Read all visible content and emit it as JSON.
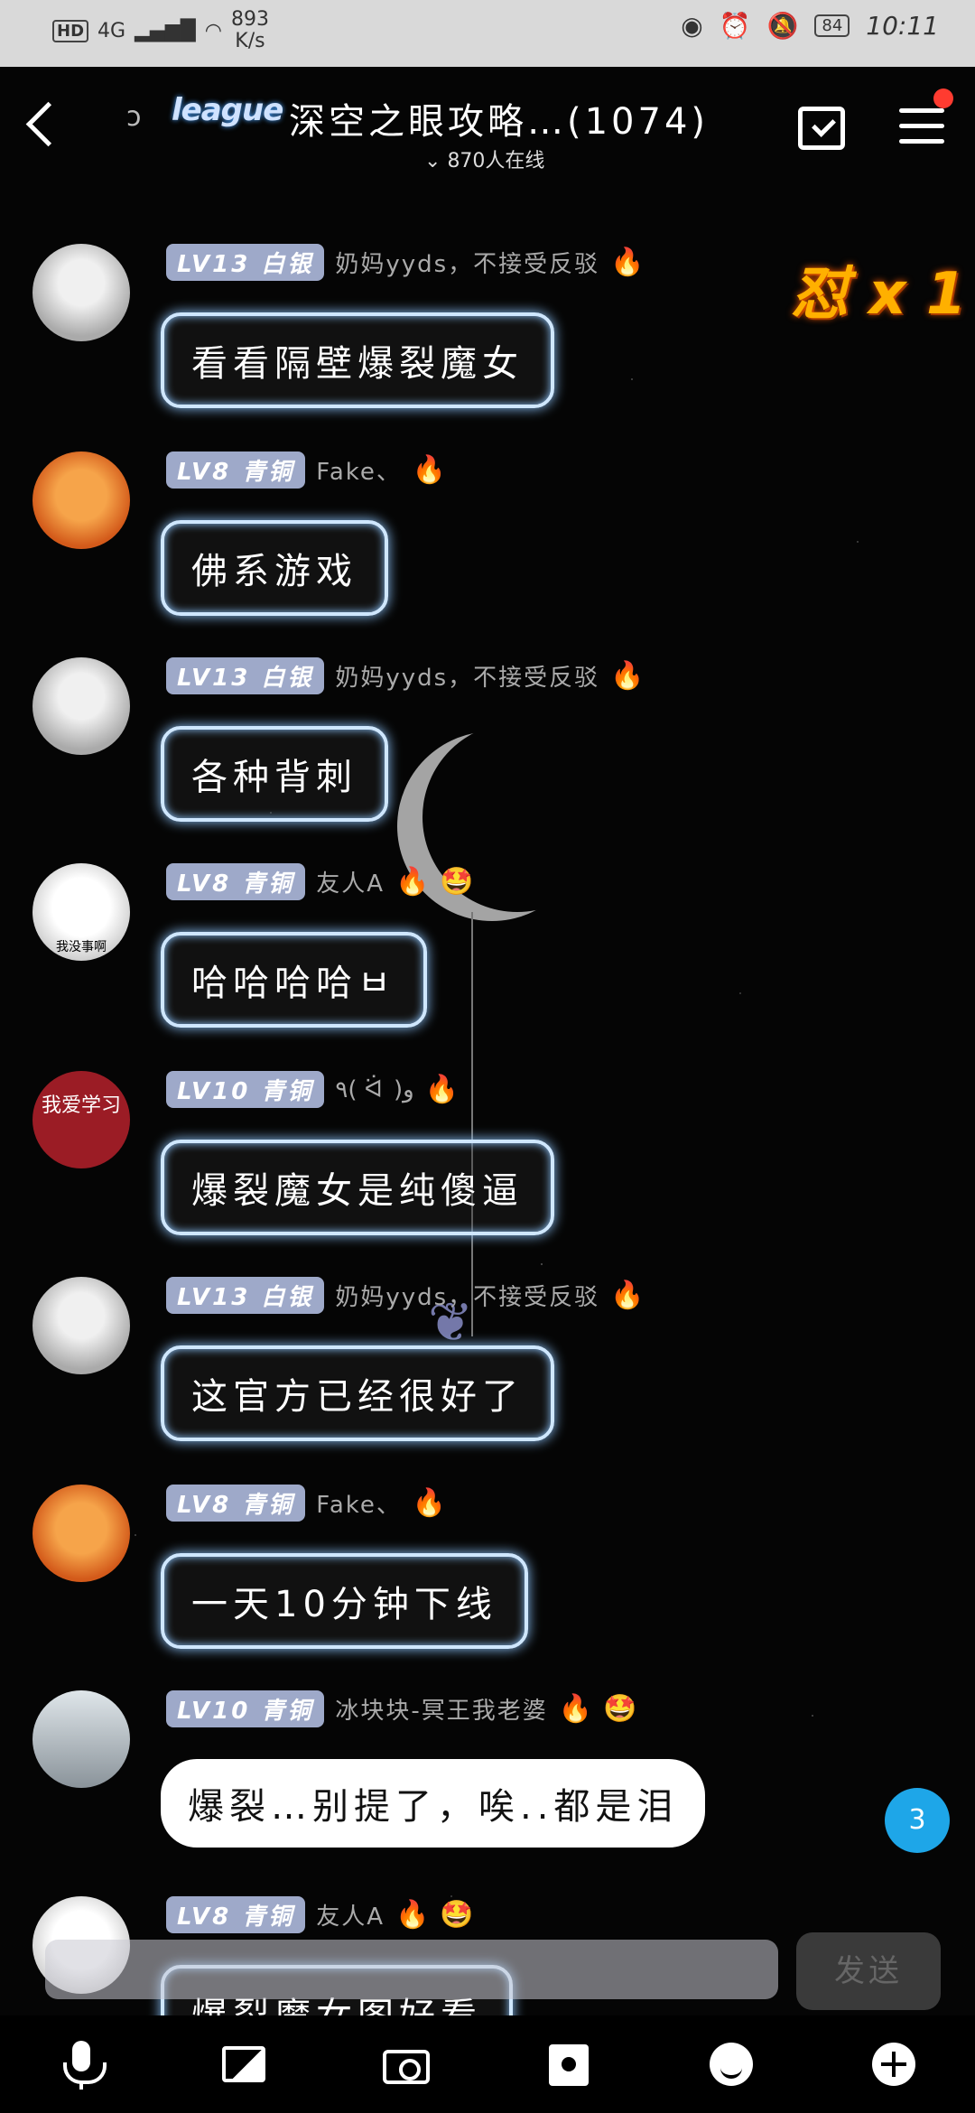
{
  "status_bar": {
    "network": "4G",
    "hd": "HD",
    "speed": "893\nK/s",
    "battery": "84",
    "time": "10:11"
  },
  "header": {
    "logo_text": "league",
    "title": "深空之眼攻略…(1074)",
    "online": "870人在线"
  },
  "combo": "怼 x 1",
  "messages": [
    {
      "level": "LV13 白银",
      "nick": "奶妈yyds，不接受反驳",
      "badges": [
        "🔥"
      ],
      "text": "看看隔壁爆裂魔女",
      "style": "glow"
    },
    {
      "level": "LV8 青铜",
      "nick": "Fake、",
      "badges": [
        "🔥"
      ],
      "text": "佛系游戏",
      "style": "glow"
    },
    {
      "level": "LV13 白银",
      "nick": "奶妈yyds，不接受反驳",
      "badges": [
        "🔥"
      ],
      "text": "各种背刺",
      "style": "glow"
    },
    {
      "level": "LV8 青铜",
      "nick": "友人A",
      "badges": [
        "🔥",
        "🤩"
      ],
      "text": "哈哈哈哈ㅂ",
      "style": "glow"
    },
    {
      "level": "LV10 青铜",
      "nick": "٩( ᐛ )و",
      "badges": [
        "🔥"
      ],
      "text": "爆裂魔女是纯傻逼",
      "style": "glow"
    },
    {
      "level": "LV13 白银",
      "nick": "奶妈yyds，不接受反驳",
      "badges": [
        "🔥"
      ],
      "text": "这官方已经很好了",
      "style": "glow"
    },
    {
      "level": "LV8 青铜",
      "nick": "Fake、",
      "badges": [
        "🔥"
      ],
      "text": "一天10分钟下线",
      "style": "glow"
    },
    {
      "level": "LV10 青铜",
      "nick": "冰块块-冥王我老婆",
      "badges": [
        "🔥",
        "🤩"
      ],
      "text": "爆裂…别提了，唉..都是泪",
      "style": "plain"
    },
    {
      "level": "LV8 青铜",
      "nick": "友人A",
      "badges": [
        "🔥",
        "🤩"
      ],
      "text": "爆裂魔女图好看",
      "style": "glow"
    }
  ],
  "avatars": {
    "red_avatar_text": "我爱学习",
    "meme_caption": "我没事啊"
  },
  "unread_count": "3",
  "input": {
    "send_label": "发送"
  },
  "toolbar": [
    "mic-icon",
    "image-icon",
    "camera-icon",
    "gift-icon",
    "emoji-icon",
    "plus-icon"
  ]
}
